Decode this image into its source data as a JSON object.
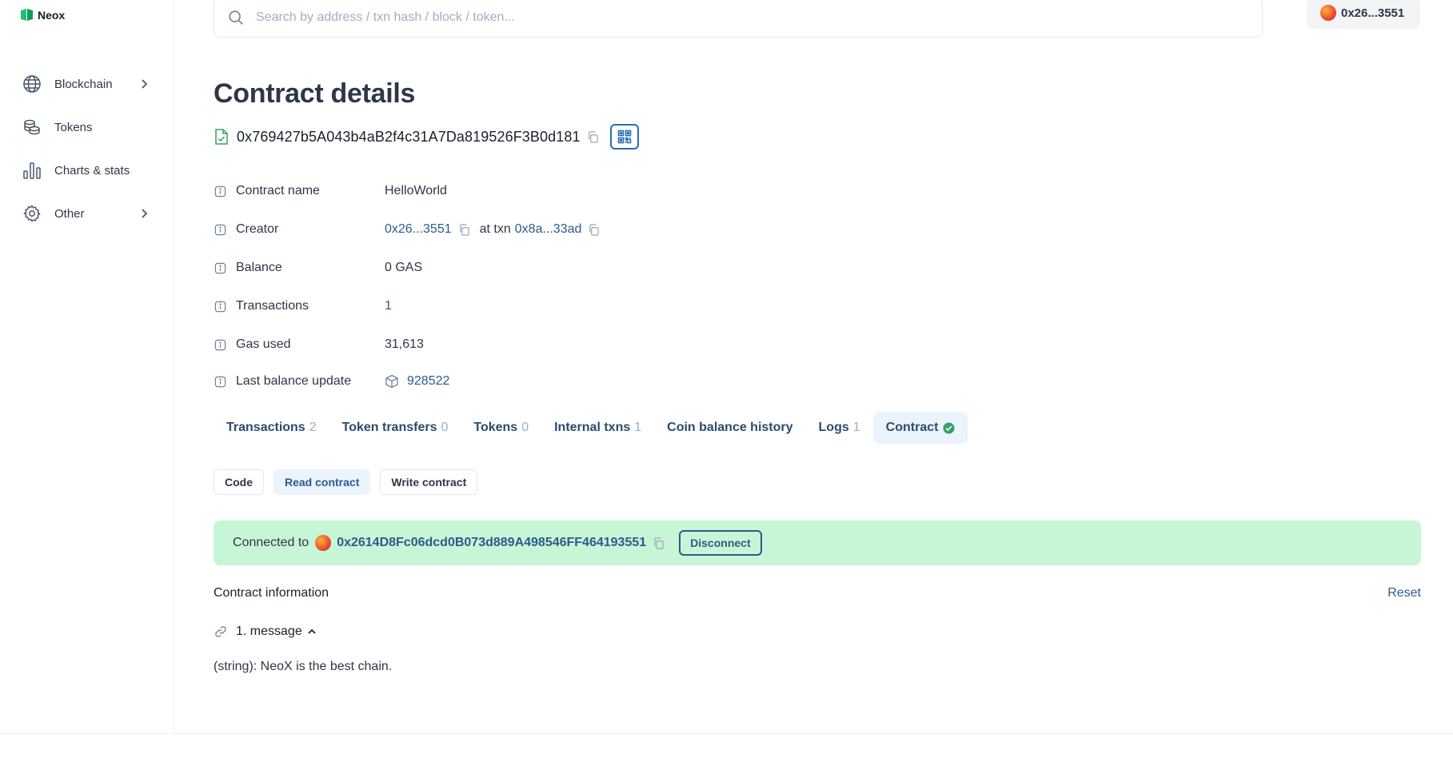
{
  "app": {
    "name": "Neox",
    "brand_color": "#1fbf75"
  },
  "sidebar": {
    "items": [
      {
        "label": "Blockchain",
        "icon": "globe-icon",
        "has_submenu": true
      },
      {
        "label": "Tokens",
        "icon": "coins-icon",
        "has_submenu": false
      },
      {
        "label": "Charts & stats",
        "icon": "bar-chart-icon",
        "has_submenu": false
      },
      {
        "label": "Other",
        "icon": "gear-icon",
        "has_submenu": true
      }
    ]
  },
  "header": {
    "search_placeholder": "Search by address / txn hash / block / token...",
    "account": "0x26...3551"
  },
  "page": {
    "title": "Contract details",
    "address": "0x769427b5A043b4aB2f4c31A7Da819526F3B0d181"
  },
  "details": {
    "contract_name": {
      "label": "Contract name",
      "value": "HelloWorld"
    },
    "creator": {
      "label": "Creator",
      "value": "0x26...3551",
      "at_txn": "at txn",
      "txn": "0x8a...33ad"
    },
    "balance": {
      "label": "Balance",
      "value": "0 GAS"
    },
    "transactions": {
      "label": "Transactions",
      "value": "1"
    },
    "gas_used": {
      "label": "Gas used",
      "value": "31,613"
    },
    "last_balance_update": {
      "label": "Last balance update",
      "value": "928522"
    }
  },
  "tabs": [
    {
      "label": "Transactions",
      "count": "2"
    },
    {
      "label": "Token transfers",
      "count": "0"
    },
    {
      "label": "Tokens",
      "count": "0"
    },
    {
      "label": "Internal txns",
      "count": "1"
    },
    {
      "label": "Coin balance history",
      "count": ""
    },
    {
      "label": "Logs",
      "count": "1"
    },
    {
      "label": "Contract",
      "count": "",
      "active": true,
      "verified": true
    }
  ],
  "subtabs": [
    {
      "label": "Code"
    },
    {
      "label": "Read contract",
      "active": true
    },
    {
      "label": "Write contract"
    }
  ],
  "connection": {
    "prefix": "Connected to",
    "address": "0x2614D8Fc06dcd0B073d889A498546FF464193551",
    "disconnect_label": "Disconnect",
    "bg_color": "#c6f6d5"
  },
  "contract_info": {
    "title": "Contract information",
    "reset_label": "Reset",
    "method": "1. message",
    "result": "(string): NeoX is the best chain."
  }
}
